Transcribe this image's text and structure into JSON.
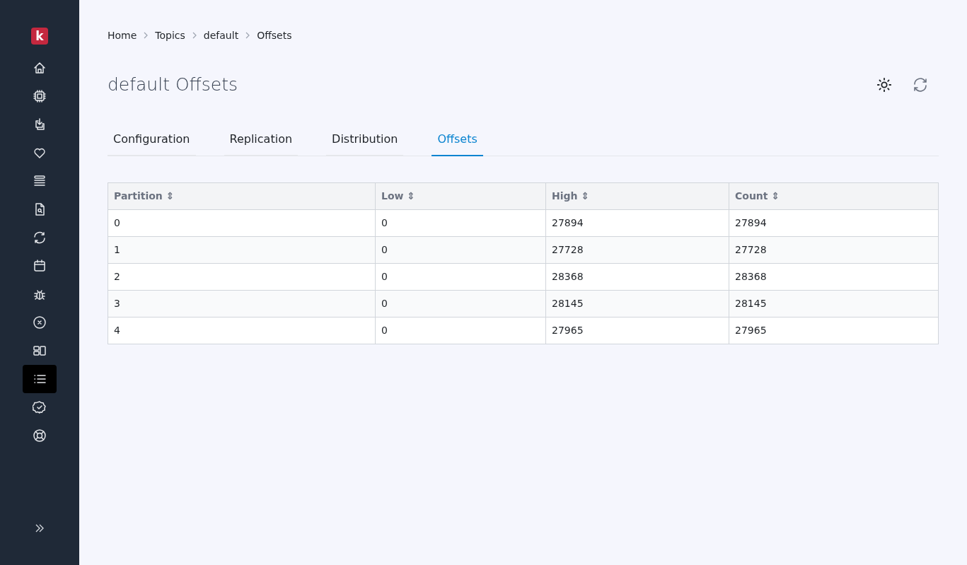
{
  "logo": {
    "text": "k"
  },
  "sidebar": {
    "items": [
      {
        "kind": "home",
        "selected": false
      },
      {
        "kind": "chip",
        "selected": false
      },
      {
        "kind": "download",
        "selected": false
      },
      {
        "kind": "heart",
        "selected": false
      },
      {
        "kind": "stack",
        "selected": false
      },
      {
        "kind": "file-search",
        "selected": false
      },
      {
        "kind": "refresh",
        "selected": false
      },
      {
        "kind": "calendar",
        "selected": false
      },
      {
        "kind": "bug",
        "selected": false
      },
      {
        "kind": "x-circle",
        "selected": false
      },
      {
        "kind": "layout",
        "selected": false
      },
      {
        "kind": "list",
        "selected": true
      },
      {
        "kind": "badge-check",
        "selected": false
      },
      {
        "kind": "lifebuoy",
        "selected": false
      }
    ]
  },
  "breadcrumb": [
    "Home",
    "Topics",
    "default",
    "Offsets"
  ],
  "page_title": "default Offsets",
  "tabs": [
    {
      "label": "Configuration",
      "selected": false
    },
    {
      "label": "Replication",
      "selected": false
    },
    {
      "label": "Distribution",
      "selected": false
    },
    {
      "label": "Offsets",
      "selected": true
    }
  ],
  "table": {
    "columns": [
      {
        "label": "Partition",
        "sort": "⇕"
      },
      {
        "label": "Low",
        "sort": "⇕"
      },
      {
        "label": "High",
        "sort": "⇕"
      },
      {
        "label": "Count",
        "sort": "⇕"
      }
    ],
    "rows": [
      [
        "0",
        "0",
        "27894",
        "27894"
      ],
      [
        "1",
        "0",
        "27728",
        "27728"
      ],
      [
        "2",
        "0",
        "28368",
        "28368"
      ],
      [
        "3",
        "0",
        "28145",
        "28145"
      ],
      [
        "4",
        "0",
        "27965",
        "27965"
      ]
    ]
  }
}
